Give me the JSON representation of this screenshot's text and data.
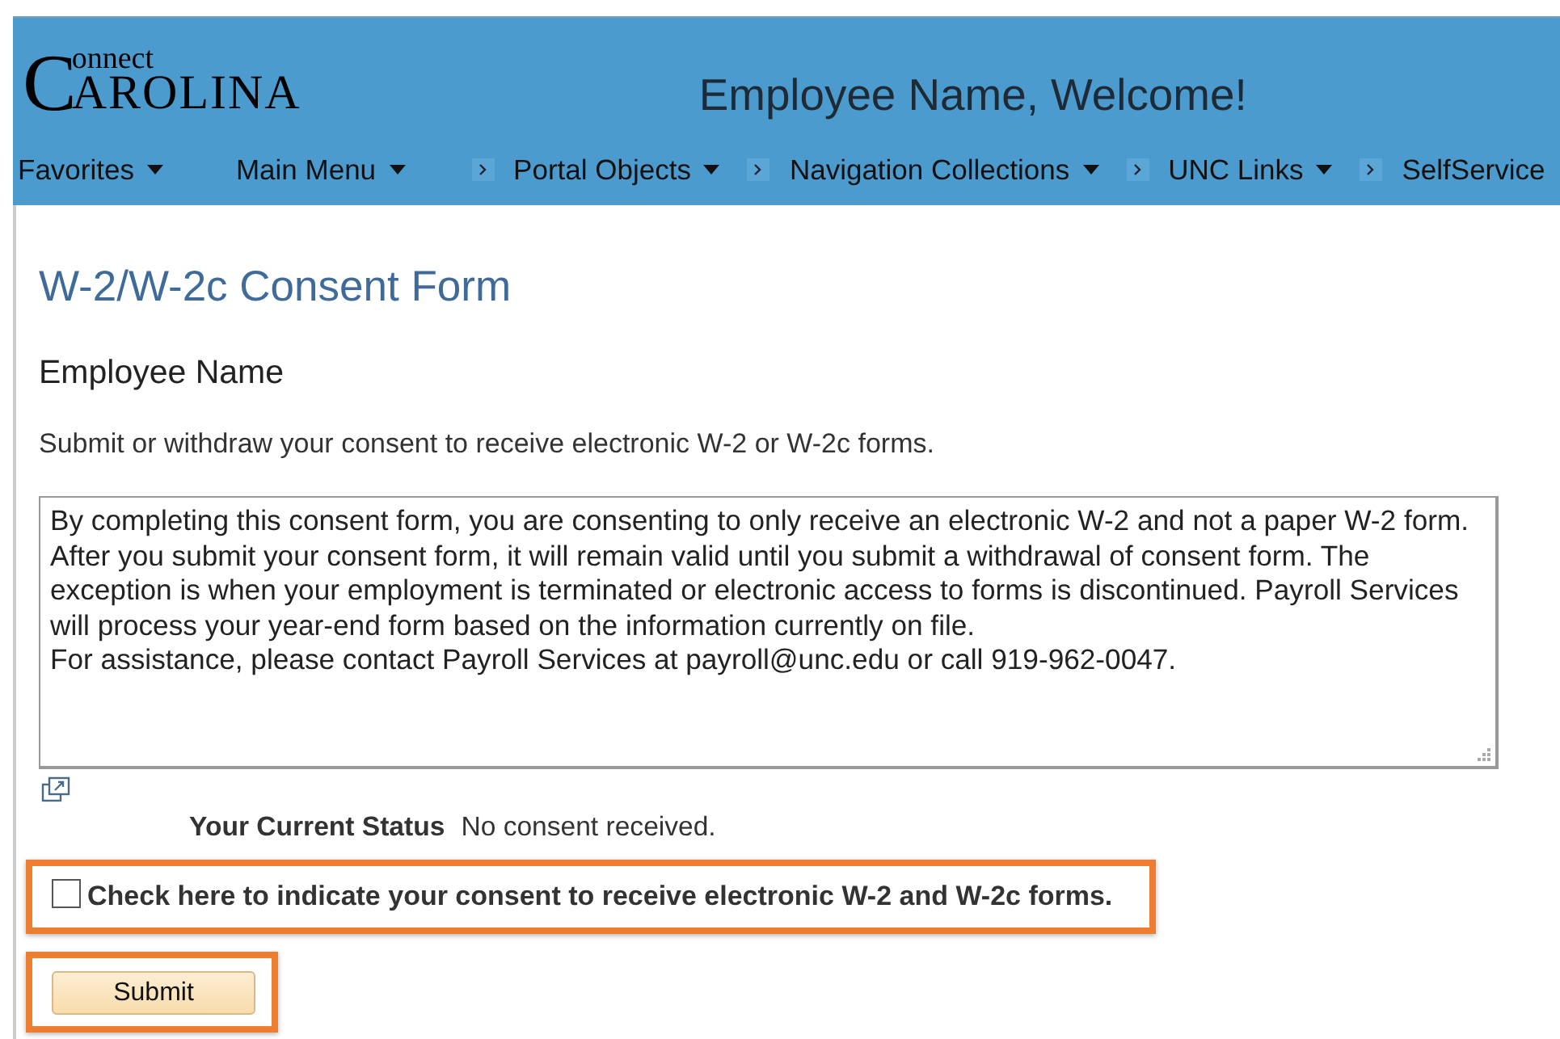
{
  "header": {
    "logo": {
      "initial": "C",
      "line1": "onnect",
      "line2": "AROLINA"
    },
    "welcome": "Employee Name, Welcome!"
  },
  "nav": [
    {
      "label": "Favorites",
      "separator_before": false,
      "dropdown": true
    },
    {
      "label": "Main Menu",
      "separator_before": false,
      "dropdown": true
    },
    {
      "label": "Portal Objects",
      "separator_before": true,
      "dropdown": true
    },
    {
      "label": "Navigation Collections",
      "separator_before": true,
      "dropdown": true
    },
    {
      "label": "UNC Links",
      "separator_before": true,
      "dropdown": true
    },
    {
      "label": "SelfService",
      "separator_before": true,
      "dropdown": false
    }
  ],
  "page_title": "W-2/W-2c Consent Form",
  "employee_name": "Employee Name",
  "instructions": "Submit or withdraw your consent to receive electronic W-2 or W-2c forms.",
  "consent_text": "By completing this consent form, you are consenting to only receive an electronic W-2 and not a paper W-2 form.\nAfter you submit your consent form, it will remain valid until you submit a withdrawal of consent form. The exception is when your employment is terminated or electronic access to forms is discontinued. Payroll Services will process your year-end form based on the information currently on file.\nFor assistance, please contact Payroll Services at payroll@unc.edu or call 919-962-0047.",
  "status": {
    "label": "Your Current Status",
    "value": "No consent received."
  },
  "consent_checkbox": {
    "label": "Check here to indicate your consent to receive electronic W-2 and W-2c forms.",
    "checked": false,
    "highlighted": true
  },
  "submit": {
    "label": "Submit",
    "highlighted": true
  }
}
